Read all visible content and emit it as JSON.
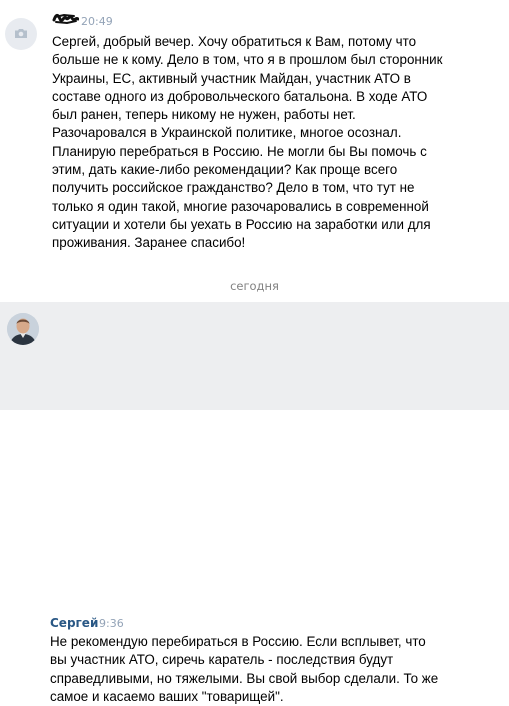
{
  "messages": [
    {
      "author": "",
      "time": "20:49",
      "avatar": "camera-icon",
      "text": "Сергей, добрый вечер. Хочу обратиться к Вам, потому что\nбольше не к кому. Дело в том, что я в прошлом был сторонник\nУкраины, ЕС, активный участник Майдан, участник АТО в\nсоставе одного из добровольческого батальона. В ходе АТО\nбыл ранен, теперь никому не нужен, работы нет.\nРазочаровался в Украинской политике, многое осознал.\nПланирую перебраться в Россию. Не могли бы Вы помочь с\nэтим, дать какие-либо рекомендации? Как проще всего\nполучить российское гражданство? Дело в том, что тут не\nтолько я один такой, многие разочаровались в современной\nситуации и хотели бы уехать в Россию на заработки или для\nпроживания. Заранее спасибо!"
    },
    {
      "author": "Сергей",
      "time": "9:36",
      "avatar": "user-photo",
      "text": "Не рекомендую перебираться в Россию. Если всплывет, что\nвы участник АТО, сиречь каратель - последствия будут\nсправедливыми, но тяжелыми. Вы свой выбор сделали. То же\nсамое и касаемо ваших \"товарищей\"."
    }
  ],
  "divider": "сегодня",
  "colors": {
    "author_link": "#2a5885",
    "time": "#93a3b7",
    "highlight_background": "#edeef0"
  }
}
